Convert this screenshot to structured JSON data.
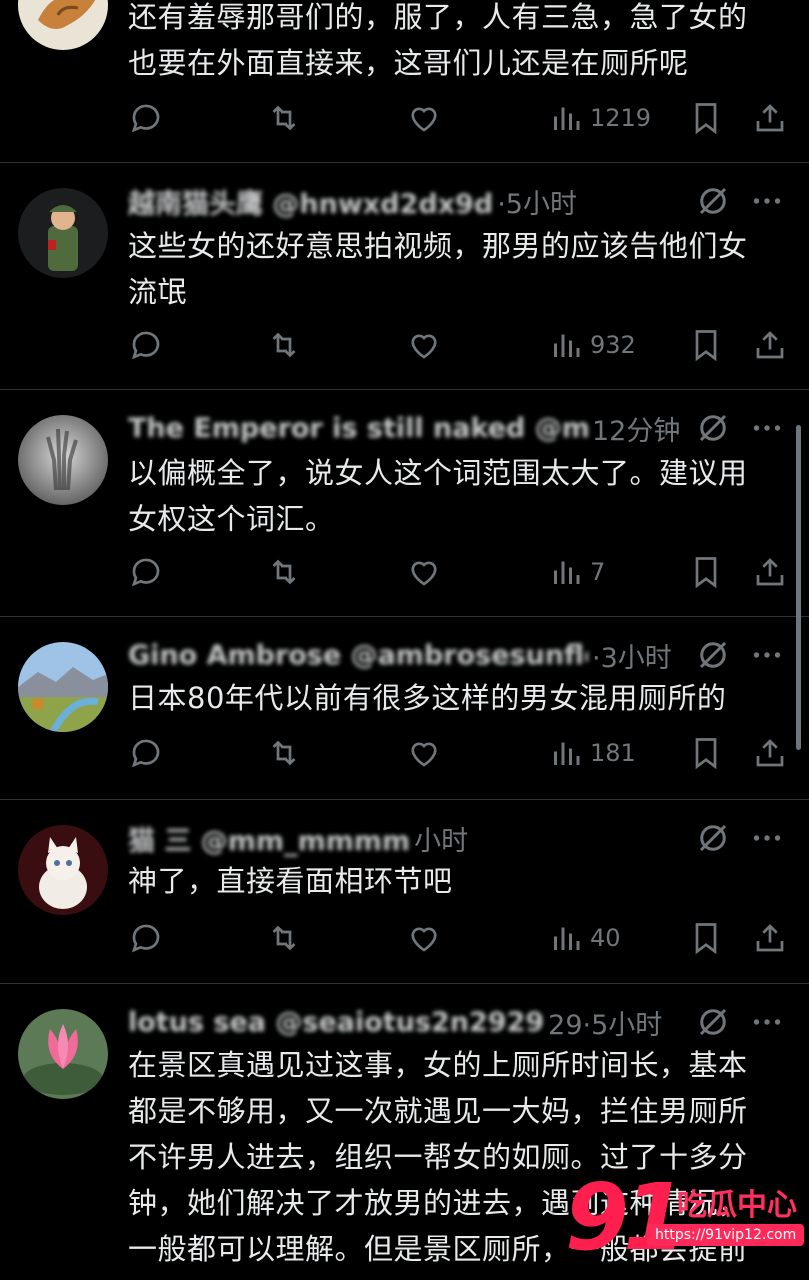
{
  "colors": {
    "background": "#000000",
    "text": "#e7e9ea",
    "muted": "#71767b",
    "divider": "#2f3336",
    "watermark": "#ff2a5a"
  },
  "icons": {
    "reply": "speech-bubble-icon",
    "retweet": "retweet-arrows-icon",
    "like": "heart-icon",
    "views": "bar-chart-icon",
    "bookmark": "bookmark-icon",
    "share": "share-upload-icon",
    "grok": "grok-slash-icon",
    "more": "more-dots-icon"
  },
  "tweets": [
    {
      "name": "",
      "time": "",
      "text": "还有羞辱那哥们的，服了，人有三急，急了女的\n也要在外面直接来，这哥们儿还是在厕所呢",
      "views": "1219"
    },
    {
      "name": "越南猫头鹰 @hnwxd2dx9d",
      "time": "·5小时",
      "text": "这些女的还好意思拍视频，那男的应该告他们女\n流氓",
      "views": "932"
    },
    {
      "name": "The Emperor is still naked @mrbj",
      "time": "12分钟",
      "text": "以偏概全了，说女人这个词范围太大了。建议用\n女权这个词汇。",
      "views": "7"
    },
    {
      "name": "Gino Ambrose @ambrosesunflower",
      "time": "·3小时",
      "text": "日本80年代以前有很多这样的男女混用厕所的",
      "views": "181"
    },
    {
      "name": "猫 三 @mm_mmmm",
      "time": "小时",
      "text": "神了，直接看面相环节吧",
      "views": "40"
    },
    {
      "name": "lotus sea @seaiotus2n2929",
      "time": "29·5小时",
      "text": "在景区真遇见过这事，女的上厕所时间长，基本\n都是不够用，又一次就遇见一大妈，拦住男厕所\n不许男人进去，组织一帮女的如厕。过了十多分\n钟，她们解决了才放男的进去，遇到这种情况，\n一般都可以理解。但是景区厕所，一般都会提前",
      "views": ""
    }
  ],
  "watermark": {
    "number": "91",
    "title": "吃瓜中心",
    "url": "https://91vip12.com"
  }
}
